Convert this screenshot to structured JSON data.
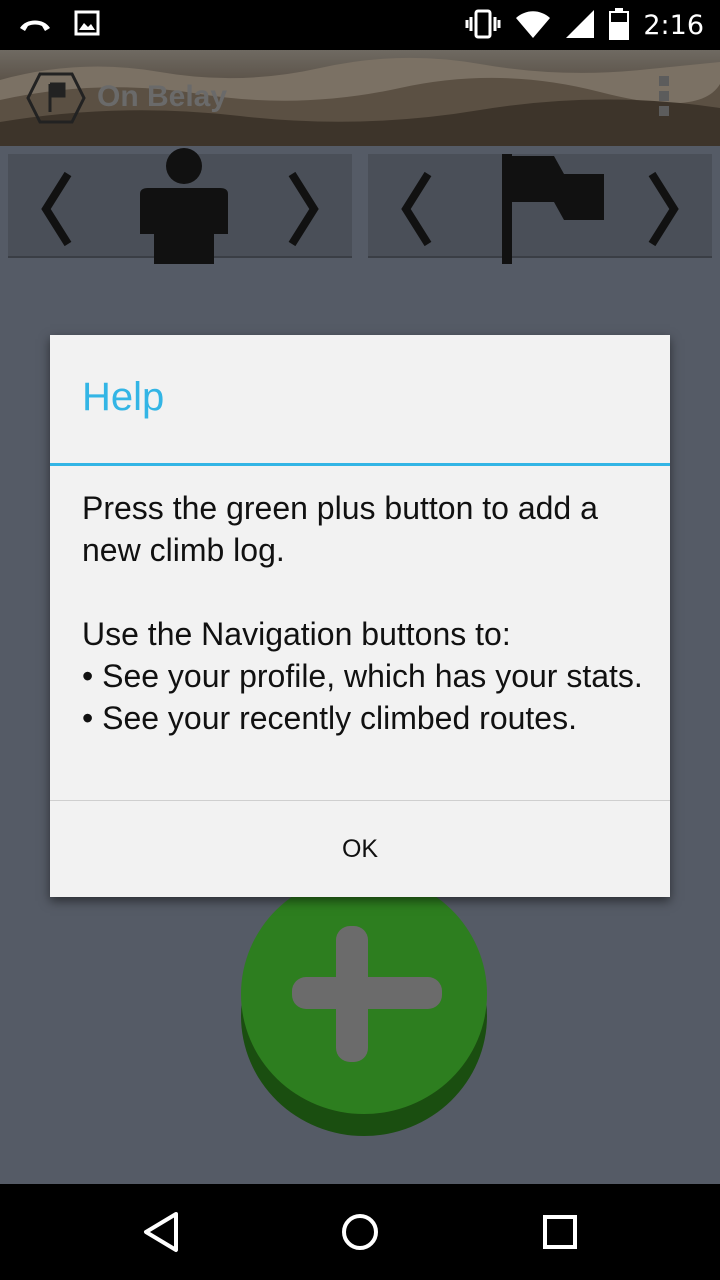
{
  "status_bar": {
    "time": "2:16",
    "icons": [
      "missed-call-icon",
      "image-icon",
      "vibrate-icon",
      "wifi-icon",
      "signal-icon",
      "battery-icon"
    ]
  },
  "app_bar": {
    "title": "On Belay",
    "icons": [
      "app-logo-icon",
      "overflow-menu-icon"
    ]
  },
  "nav_buttons": {
    "profile_icon": "person-icon",
    "routes_icon": "flag-icon"
  },
  "dialog": {
    "title": "Help",
    "line1": "Press the green plus button to add a new climb log.",
    "line2": "Use the Navigation buttons to:",
    "line3": "• See your profile, which has your stats.",
    "line4": "• See your recently climbed routes.",
    "ok_label": "OK"
  },
  "add_button": {
    "icon": "plus-icon"
  },
  "system_nav": {
    "icons": [
      "back-icon",
      "home-icon",
      "recents-icon"
    ]
  },
  "colors": {
    "accent": "#33b5e5",
    "background": "#555b66",
    "add_button": "#2a7a1a"
  }
}
